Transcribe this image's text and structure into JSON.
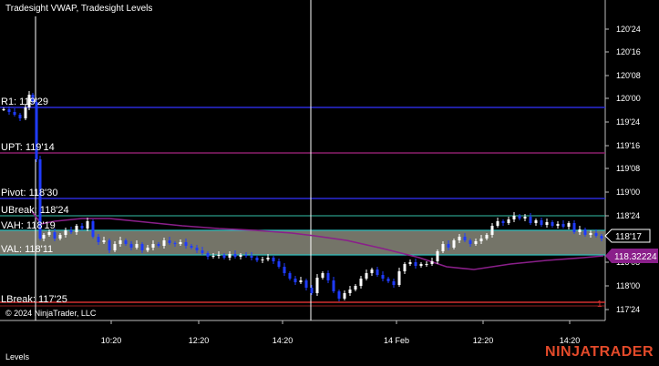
{
  "chart": {
    "title": "Tradesight VWAP, Tradesight Levels",
    "copyright": "© 2024 NinjaTrader, LLC",
    "bottom_tab": "Levels",
    "logo": "NINJATRADER",
    "price_ticks": [
      "120'24",
      "120'16",
      "120'08",
      "120'00",
      "119'24",
      "119'16",
      "119'08",
      "119'00",
      "118'24",
      "118'17",
      "118'08",
      "118'00",
      "117'24"
    ],
    "time_ticks": [
      "10:20",
      "12:20",
      "14:20",
      "14 Feb",
      "12:20",
      "14:20"
    ],
    "current_price_label": "118'17",
    "vwap_price_label": "118.32224",
    "bar_count_label": "1",
    "levels": [
      {
        "name": "R1",
        "label": "R1: 119'29",
        "color": "#2b2bd8"
      },
      {
        "name": "UPT",
        "label": "UPT: 119'14",
        "color": "#8a1f6a"
      },
      {
        "name": "Pivot",
        "label": "Pivot: 118'30",
        "color": "#2b2bd8"
      },
      {
        "name": "UBreak",
        "label": "UBreak: 118'24",
        "color": "#2a9a86"
      },
      {
        "name": "VAH",
        "label": "VAH: 118'19",
        "color": "#2fbfbf"
      },
      {
        "name": "VAL",
        "label": "VAL: 118'11",
        "color": "#2fbfbf"
      },
      {
        "name": "LBreak",
        "label": "LBreak: 117'25",
        "color": "#d23030"
      }
    ],
    "colors": {
      "background": "#000000",
      "candle_up": "#ffffff",
      "candle_down": "#1f3bff",
      "vwap": "#8a1f8a",
      "value_area_fill": "#7a7a6e",
      "logo": "#e34a2a"
    }
  }
}
